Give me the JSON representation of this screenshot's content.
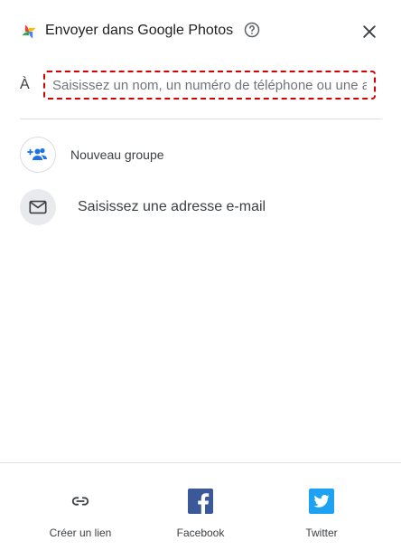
{
  "header": {
    "title": "Envoyer dans Google Photos",
    "logo_icon": "google-photos-pinwheel-icon",
    "help_icon": "help-circle-icon",
    "close_icon": "close-icon"
  },
  "recipient": {
    "label": "À",
    "placeholder": "Saisissez un nom, un numéro de téléphone ou une adresse e-mail",
    "value": ""
  },
  "options": [
    {
      "label": "Nouveau groupe",
      "icon": "add-group-icon",
      "icon_color": "#1a73e8"
    },
    {
      "label": "Saisissez une adresse e-mail",
      "icon": "mail-icon",
      "icon_color": "#3c4043"
    }
  ],
  "share": [
    {
      "label": "Créer un lien",
      "icon": "link-icon"
    },
    {
      "label": "Facebook",
      "icon": "facebook-icon",
      "color": "#3b5998"
    },
    {
      "label": "Twitter",
      "icon": "twitter-icon",
      "color": "#1da1f2"
    }
  ],
  "colors": {
    "focus_outline": "#d50000",
    "accent": "#1a73e8"
  }
}
